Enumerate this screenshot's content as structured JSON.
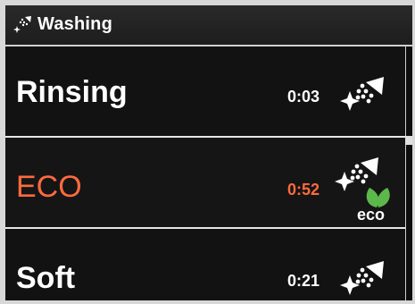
{
  "header": {
    "title": "Washing",
    "icon": "shower-sparkle-icon"
  },
  "programs": [
    {
      "label": "Rinsing",
      "time": "0:03",
      "icon": "shower-sparkle-icon",
      "highlight": false
    },
    {
      "label": "ECO",
      "time": "0:52",
      "icon": "shower-sparkle-eco-icon",
      "badge": "eco",
      "highlight": true
    },
    {
      "label": "Soft",
      "time": "0:21",
      "icon": "shower-sparkle-icon",
      "highlight": false
    }
  ],
  "colors": {
    "background": "#0d0d0d",
    "text": "#ffffff",
    "selected": "#ff6a3d",
    "eco_leaf": "#5cb84a",
    "divider": "#e6e6e6"
  }
}
